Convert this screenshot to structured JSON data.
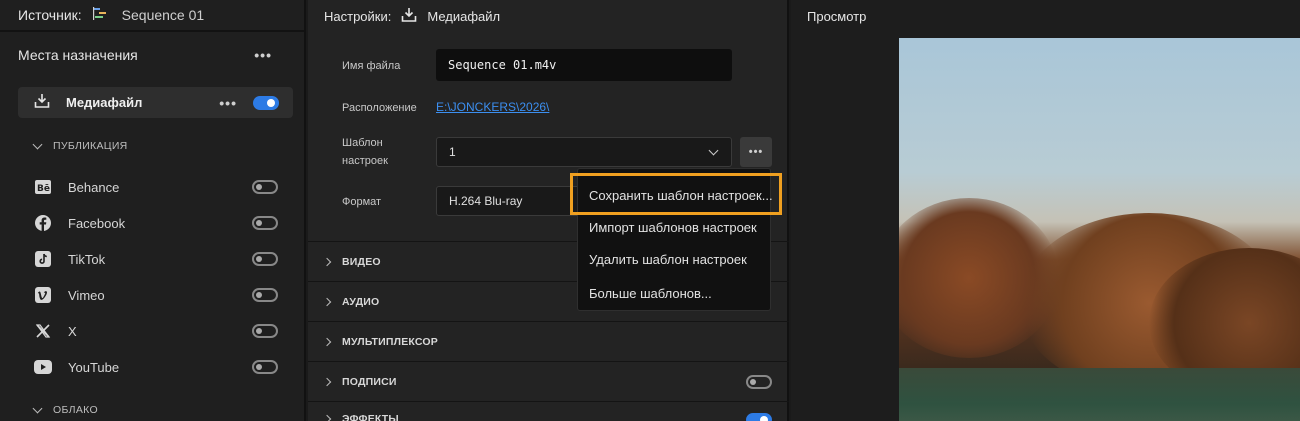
{
  "left": {
    "source_label": "Источник:",
    "sequence_name": "Sequence 01",
    "destinations_title": "Места назначения",
    "more_glyph": "•••",
    "media_file": {
      "label": "Медиафайл",
      "enabled": true
    },
    "publication_section": "ПУБЛИКАЦИЯ",
    "cloud_section": "ОБЛАКО",
    "publish_targets": [
      {
        "label": "Behance",
        "icon": "behance-icon",
        "enabled": false
      },
      {
        "label": "Facebook",
        "icon": "facebook-icon",
        "enabled": false
      },
      {
        "label": "TikTok",
        "icon": "tiktok-icon",
        "enabled": false
      },
      {
        "label": "Vimeo",
        "icon": "vimeo-icon",
        "enabled": false
      },
      {
        "label": "X",
        "icon": "x-icon",
        "enabled": false
      },
      {
        "label": "YouTube",
        "icon": "youtube-icon",
        "enabled": false
      }
    ]
  },
  "settings": {
    "header_label": "Настройки:",
    "header_target": "Медиафайл",
    "file_name_label": "Имя файла",
    "file_name_value": "Sequence 01.m4v",
    "location_label": "Расположение",
    "location_value": "E:\\JONCKERS\\2026\\",
    "preset_label_line1": "Шаблон",
    "preset_label_line2": "настроек",
    "preset_value": "1",
    "format_label": "Формат",
    "format_value": "H.264 Blu-ray",
    "more_glyph": "•••",
    "sections": [
      {
        "label": "ВИДЕО"
      },
      {
        "label": "АУДИО"
      },
      {
        "label": "МУЛЬТИПЛЕКСОР"
      },
      {
        "label": "ПОДПИСИ",
        "toggle": false
      },
      {
        "label": "ЭФФЕКТЫ",
        "toggle": true
      }
    ]
  },
  "preset_menu": {
    "items": [
      "Сохранить шаблон настроек...",
      "Импорт шаблонов настроек",
      "Удалить шаблон настроек",
      "Больше шаблонов..."
    ],
    "highlight_color": "#f0a020"
  },
  "preview": {
    "title": "Просмотр"
  },
  "colors": {
    "accent": "#2d7be5",
    "link": "#3c8ff0"
  }
}
